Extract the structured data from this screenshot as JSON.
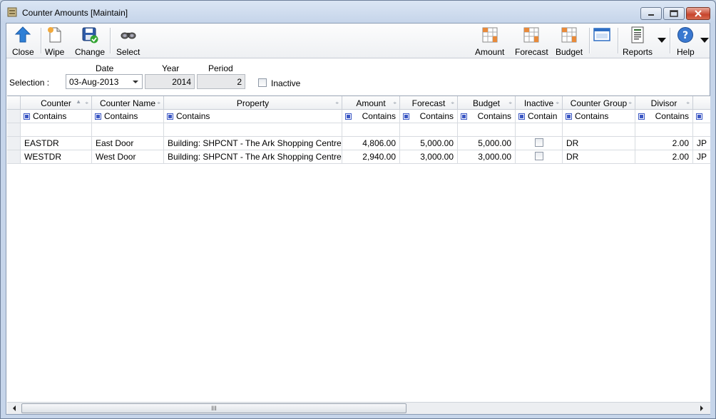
{
  "window": {
    "title": "Counter Amounts [Maintain]"
  },
  "toolbar": {
    "close_label": "Close",
    "wipe_label": "Wipe",
    "change_label": "Change",
    "select_label": "Select",
    "amount_label": "Amount",
    "forecast_label": "Forecast",
    "budget_label": "Budget",
    "reports_label": "Reports",
    "help_label": "Help"
  },
  "selection": {
    "label": "Selection :",
    "date_header": "Date",
    "year_header": "Year",
    "period_header": "Period",
    "date_value": "03-Aug-2013",
    "year_value": "2014",
    "period_value": "2",
    "inactive_label": "Inactive"
  },
  "grid": {
    "columns": [
      "Counter",
      "Counter Name",
      "Property",
      "Amount",
      "Forecast",
      "Budget",
      "Inactive",
      "Counter Group",
      "Divisor"
    ],
    "filters": [
      "Contains",
      "Contains",
      "Contains",
      "Contains",
      "Contains",
      "Contains",
      "Contain",
      "Contains",
      "Contains"
    ],
    "rows": [
      {
        "counter": "EASTDR",
        "name": "East Door",
        "property": "Building: SHPCNT - The Ark Shopping Centre",
        "amount": "4,806.00",
        "forecast": "5,000.00",
        "budget": "5,000.00",
        "group": "DR",
        "divisor": "2.00",
        "extra": "JP"
      },
      {
        "counter": "WESTDR",
        "name": "West Door",
        "property": "Building: SHPCNT - The Ark Shopping Centre",
        "amount": "2,940.00",
        "forecast": "3,000.00",
        "budget": "3,000.00",
        "group": "DR",
        "divisor": "2.00",
        "extra": "JP"
      }
    ]
  },
  "icons": {
    "close": "up-arrow-icon",
    "wipe": "new-document-icon",
    "change": "save-check-icon",
    "select": "binoculars-icon",
    "amount": "grid-icon",
    "forecast": "grid-icon",
    "budget": "grid-icon",
    "window_toggle": "window-icon",
    "reports": "report-icon",
    "help": "help-icon"
  },
  "colors": {
    "accent": "#3b57c4",
    "close_button": "#c7442c"
  }
}
